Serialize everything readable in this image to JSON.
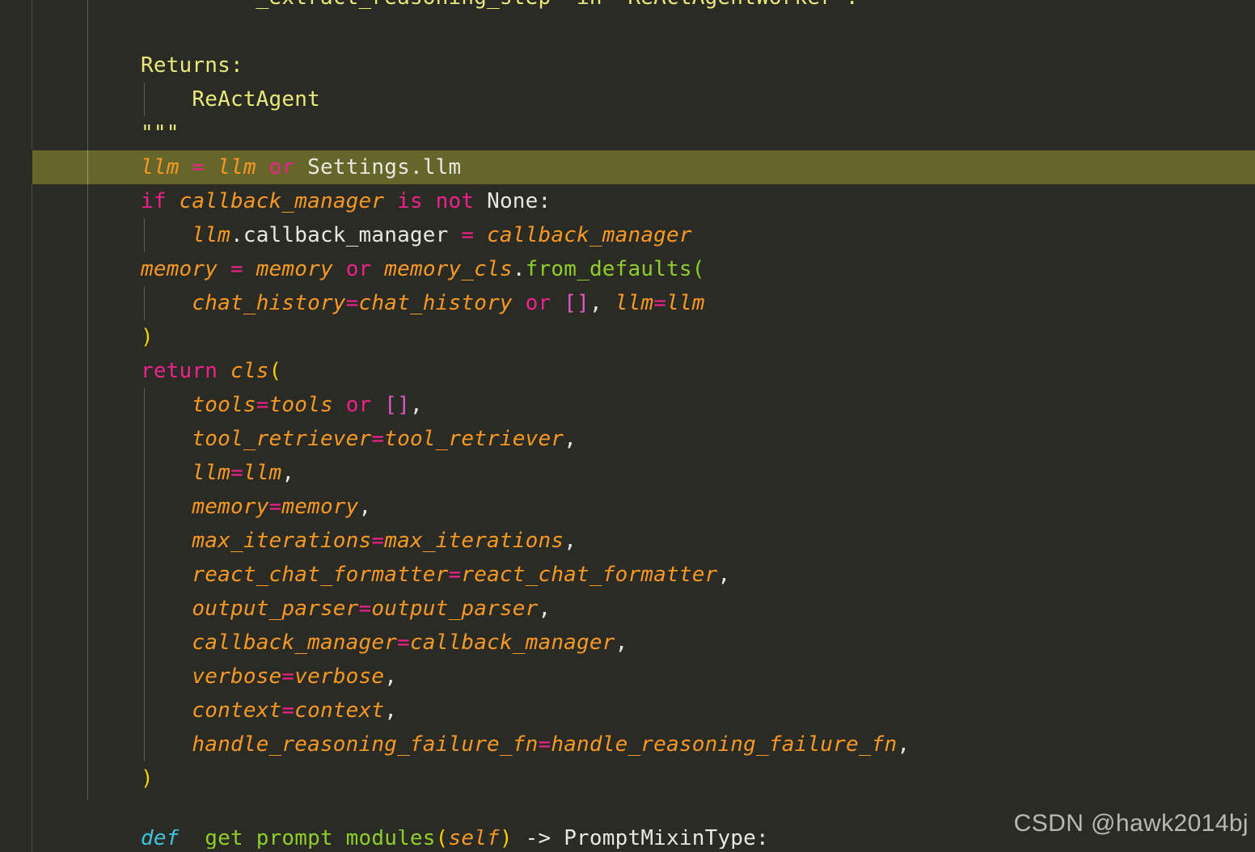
{
  "editor": {
    "language": "python",
    "theme_background": "#2b2b26",
    "current_line_highlight": "#66662b",
    "colors": {
      "docstring": "#e9e97a",
      "keyword": "#f0218a",
      "identifier": "#f79824",
      "attribute": "#e8e8e2",
      "function": "#8fce2a",
      "bracket": "#f5d000",
      "list_bracket": "#e255c4",
      "def_keyword": "#3fc1e0",
      "indent_guide": "#5b5b52"
    }
  },
  "code": {
    "lines": [
      {
        "id": "l01",
        "clipped": "top",
        "indent_guide": false,
        "tokens": [
          {
            "t": "doc",
            "s": "        `_extract_reasoning_step` in `ReActAgentWorker`."
          }
        ]
      },
      {
        "id": "l02",
        "indent_guide": false,
        "tokens": [
          {
            "t": "doc",
            "s": ""
          }
        ]
      },
      {
        "id": "l03",
        "indent_guide": false,
        "tokens": [
          {
            "t": "doc",
            "s": "Returns:"
          }
        ]
      },
      {
        "id": "l04",
        "indent_guide": true,
        "tokens": [
          {
            "t": "doc",
            "s": "    ReActAgent"
          }
        ]
      },
      {
        "id": "l05",
        "indent_guide": false,
        "tokens": [
          {
            "t": "doc",
            "s": "\"\"\""
          }
        ]
      },
      {
        "id": "l06",
        "highlight": true,
        "indent_guide": false,
        "tokens": [
          {
            "t": "var",
            "s": "llm"
          },
          {
            "t": "pun",
            "s": " "
          },
          {
            "t": "eq",
            "s": "="
          },
          {
            "t": "pun",
            "s": " "
          },
          {
            "t": "var",
            "s": "llm"
          },
          {
            "t": "pun",
            "s": " "
          },
          {
            "t": "kw",
            "s": "or"
          },
          {
            "t": "pun",
            "s": " "
          },
          {
            "t": "attr",
            "s": "Settings.llm"
          }
        ]
      },
      {
        "id": "l07",
        "indent_guide": false,
        "tokens": [
          {
            "t": "kw",
            "s": "if"
          },
          {
            "t": "pun",
            "s": " "
          },
          {
            "t": "var",
            "s": "callback_manager"
          },
          {
            "t": "pun",
            "s": " "
          },
          {
            "t": "kw",
            "s": "is"
          },
          {
            "t": "pun",
            "s": " "
          },
          {
            "t": "kw",
            "s": "not"
          },
          {
            "t": "pun",
            "s": " "
          },
          {
            "t": "attr",
            "s": "None:"
          }
        ]
      },
      {
        "id": "l08",
        "indent_guide": true,
        "tokens": [
          {
            "t": "pun",
            "s": "    "
          },
          {
            "t": "var",
            "s": "llm"
          },
          {
            "t": "attr",
            "s": ".callback_manager"
          },
          {
            "t": "pun",
            "s": " "
          },
          {
            "t": "eq",
            "s": "="
          },
          {
            "t": "pun",
            "s": " "
          },
          {
            "t": "var",
            "s": "callback_manager"
          }
        ]
      },
      {
        "id": "l09",
        "indent_guide": false,
        "tokens": [
          {
            "t": "var",
            "s": "memory"
          },
          {
            "t": "pun",
            "s": " "
          },
          {
            "t": "eq",
            "s": "="
          },
          {
            "t": "pun",
            "s": " "
          },
          {
            "t": "var",
            "s": "memory"
          },
          {
            "t": "pun",
            "s": " "
          },
          {
            "t": "kw",
            "s": "or"
          },
          {
            "t": "pun",
            "s": " "
          },
          {
            "t": "var",
            "s": "memory_cls"
          },
          {
            "t": "attr",
            "s": "."
          },
          {
            "t": "fn",
            "s": "from_defaults"
          },
          {
            "t": "fn",
            "s": "("
          }
        ]
      },
      {
        "id": "l10",
        "indent_guide": true,
        "tokens": [
          {
            "t": "pun",
            "s": "    "
          },
          {
            "t": "var",
            "s": "chat_history"
          },
          {
            "t": "eq",
            "s": "="
          },
          {
            "t": "var",
            "s": "chat_history"
          },
          {
            "t": "pun",
            "s": " "
          },
          {
            "t": "kw",
            "s": "or"
          },
          {
            "t": "pun",
            "s": " "
          },
          {
            "t": "brk",
            "s": "[]"
          },
          {
            "t": "pun",
            "s": ", "
          },
          {
            "t": "var",
            "s": "llm"
          },
          {
            "t": "eq",
            "s": "="
          },
          {
            "t": "var",
            "s": "llm"
          }
        ]
      },
      {
        "id": "l11",
        "indent_guide": false,
        "tokens": [
          {
            "t": "par",
            "s": ")"
          }
        ]
      },
      {
        "id": "l12",
        "indent_guide": false,
        "tokens": [
          {
            "t": "kw",
            "s": "return"
          },
          {
            "t": "pun",
            "s": " "
          },
          {
            "t": "var",
            "s": "cls"
          },
          {
            "t": "par",
            "s": "("
          }
        ]
      },
      {
        "id": "l13",
        "indent_guide": true,
        "tokens": [
          {
            "t": "pun",
            "s": "    "
          },
          {
            "t": "var",
            "s": "tools"
          },
          {
            "t": "eq",
            "s": "="
          },
          {
            "t": "var",
            "s": "tools"
          },
          {
            "t": "pun",
            "s": " "
          },
          {
            "t": "kw",
            "s": "or"
          },
          {
            "t": "pun",
            "s": " "
          },
          {
            "t": "brk",
            "s": "[]"
          },
          {
            "t": "pun",
            "s": ","
          }
        ]
      },
      {
        "id": "l14",
        "indent_guide": true,
        "tokens": [
          {
            "t": "pun",
            "s": "    "
          },
          {
            "t": "var",
            "s": "tool_retriever"
          },
          {
            "t": "eq",
            "s": "="
          },
          {
            "t": "var",
            "s": "tool_retriever"
          },
          {
            "t": "pun",
            "s": ","
          }
        ]
      },
      {
        "id": "l15",
        "indent_guide": true,
        "tokens": [
          {
            "t": "pun",
            "s": "    "
          },
          {
            "t": "var",
            "s": "llm"
          },
          {
            "t": "eq",
            "s": "="
          },
          {
            "t": "var",
            "s": "llm"
          },
          {
            "t": "pun",
            "s": ","
          }
        ]
      },
      {
        "id": "l16",
        "indent_guide": true,
        "tokens": [
          {
            "t": "pun",
            "s": "    "
          },
          {
            "t": "var",
            "s": "memory"
          },
          {
            "t": "eq",
            "s": "="
          },
          {
            "t": "var",
            "s": "memory"
          },
          {
            "t": "pun",
            "s": ","
          }
        ]
      },
      {
        "id": "l17",
        "indent_guide": true,
        "tokens": [
          {
            "t": "pun",
            "s": "    "
          },
          {
            "t": "var",
            "s": "max_iterations"
          },
          {
            "t": "eq",
            "s": "="
          },
          {
            "t": "var",
            "s": "max_iterations"
          },
          {
            "t": "pun",
            "s": ","
          }
        ]
      },
      {
        "id": "l18",
        "indent_guide": true,
        "tokens": [
          {
            "t": "pun",
            "s": "    "
          },
          {
            "t": "var",
            "s": "react_chat_formatter"
          },
          {
            "t": "eq",
            "s": "="
          },
          {
            "t": "var",
            "s": "react_chat_formatter"
          },
          {
            "t": "pun",
            "s": ","
          }
        ]
      },
      {
        "id": "l19",
        "indent_guide": true,
        "tokens": [
          {
            "t": "pun",
            "s": "    "
          },
          {
            "t": "var",
            "s": "output_parser"
          },
          {
            "t": "eq",
            "s": "="
          },
          {
            "t": "var",
            "s": "output_parser"
          },
          {
            "t": "pun",
            "s": ","
          }
        ]
      },
      {
        "id": "l20",
        "indent_guide": true,
        "tokens": [
          {
            "t": "pun",
            "s": "    "
          },
          {
            "t": "var",
            "s": "callback_manager"
          },
          {
            "t": "eq",
            "s": "="
          },
          {
            "t": "var",
            "s": "callback_manager"
          },
          {
            "t": "pun",
            "s": ","
          }
        ]
      },
      {
        "id": "l21",
        "indent_guide": true,
        "tokens": [
          {
            "t": "pun",
            "s": "    "
          },
          {
            "t": "var",
            "s": "verbose"
          },
          {
            "t": "eq",
            "s": "="
          },
          {
            "t": "var",
            "s": "verbose"
          },
          {
            "t": "pun",
            "s": ","
          }
        ]
      },
      {
        "id": "l22",
        "indent_guide": true,
        "tokens": [
          {
            "t": "pun",
            "s": "    "
          },
          {
            "t": "var",
            "s": "context"
          },
          {
            "t": "eq",
            "s": "="
          },
          {
            "t": "var",
            "s": "context"
          },
          {
            "t": "pun",
            "s": ","
          }
        ]
      },
      {
        "id": "l23",
        "indent_guide": true,
        "tokens": [
          {
            "t": "pun",
            "s": "    "
          },
          {
            "t": "var",
            "s": "handle_reasoning_failure_fn"
          },
          {
            "t": "eq",
            "s": "="
          },
          {
            "t": "var",
            "s": "handle_reasoning_failure_fn"
          },
          {
            "t": "pun",
            "s": ","
          }
        ]
      },
      {
        "id": "l24",
        "indent_guide": false,
        "tokens": [
          {
            "t": "par",
            "s": ")"
          }
        ]
      },
      {
        "id": "l25",
        "indent_guide": false,
        "tokens": [
          {
            "t": "pun",
            "s": ""
          }
        ]
      },
      {
        "id": "l26",
        "clipped": "bottom",
        "indent_guide": false,
        "offset": -66,
        "tokens": [
          {
            "t": "def",
            "s": "def"
          },
          {
            "t": "pun",
            "s": " "
          },
          {
            "t": "fn",
            "s": "_get_prompt_modules"
          },
          {
            "t": "par",
            "s": "("
          },
          {
            "t": "var",
            "s": "self"
          },
          {
            "t": "par",
            "s": ")"
          },
          {
            "t": "pun",
            "s": " -> "
          },
          {
            "t": "attr",
            "s": "PromptMixinType:"
          }
        ]
      }
    ]
  },
  "watermark": {
    "text": "CSDN @hawk2014bj"
  }
}
